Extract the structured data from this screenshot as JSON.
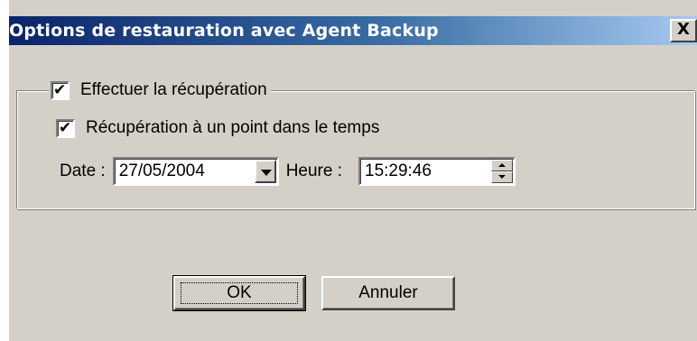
{
  "window": {
    "title": "Options de restauration avec Agent Backup",
    "close_symbol": "X",
    "close_icon": "close-icon"
  },
  "group": {
    "recovery_checkbox": {
      "label": "Effectuer la récupération",
      "checked": true
    },
    "pit_checkbox": {
      "label": "Récupération à un point dans le temps",
      "checked": true
    },
    "date_label": "Date :",
    "date_value": "27/05/2004",
    "date_dropdown_icon": "chevron-down-icon",
    "time_label": "Heure :",
    "time_value": "15:29:46",
    "time_spin_icons": [
      "spin-up-icon",
      "spin-down-icon"
    ]
  },
  "buttons": {
    "ok": "OK",
    "cancel": "Annuler"
  },
  "colors": {
    "title_bar_start": "#0a246a",
    "title_bar_end": "#a6caf0",
    "dialog_face": "#d4d0c8"
  }
}
